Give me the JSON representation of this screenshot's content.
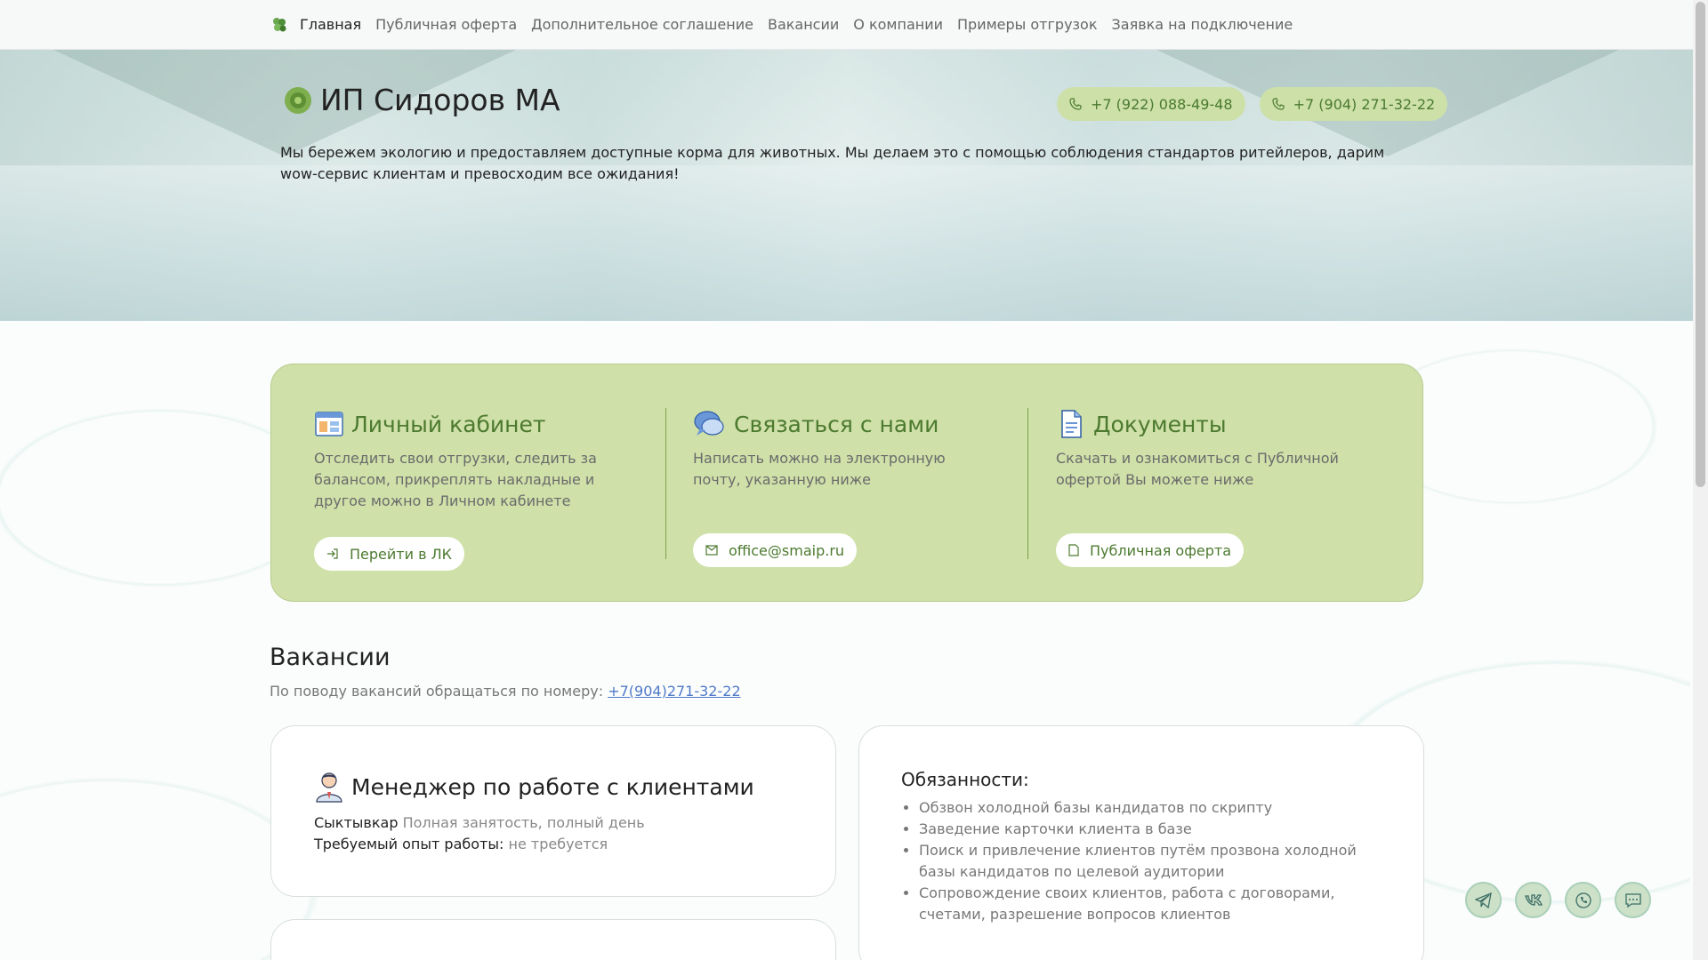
{
  "nav": {
    "items": [
      {
        "label": "Главная",
        "active": true
      },
      {
        "label": "Публичная оферта",
        "active": false
      },
      {
        "label": "Дополнительное соглашение",
        "active": false
      },
      {
        "label": "Вакансии",
        "active": false
      },
      {
        "label": "О компании",
        "active": false
      },
      {
        "label": "Примеры отгрузок",
        "active": false
      },
      {
        "label": "Заявка на подключение",
        "active": false
      }
    ]
  },
  "hero": {
    "title": "ИП Сидоров МА",
    "phones": [
      "+7 (922) 088-49-48",
      "+7 (904) 271-32-22"
    ],
    "description": "Мы бережем экологию и предоставляем доступные корма для животных. Мы делаем это с помощью соблюдения стандартов ритейлеров, дарим wow-сервис клиентам и превосходим все ожидания!"
  },
  "features": {
    "account": {
      "title": "Личный кабинет",
      "text": "Отследить свои отгрузки, следить за балансом, прикреплять накладные и другое можно в Личном кабинете",
      "button": "Перейти в ЛК"
    },
    "contact": {
      "title": "Связаться с нами",
      "text": "Написать можно на электронную почту, указанную ниже",
      "button": "office@smaip.ru"
    },
    "documents": {
      "title": "Документы",
      "text": "Скачать и ознакомиться с Публичной офертой Вы можете ниже",
      "button": "Публичная оферта"
    }
  },
  "vacancies": {
    "title": "Вакансии",
    "subtitle": "По поводу вакансий обращаться по номеру:",
    "phone_link": "+7(904)271-32-22",
    "job": {
      "title": "Менеджер по работе с клиентами",
      "city": "Сыктывкар",
      "schedule": "Полная занятость, полный день",
      "experience_label": "Требуемый опыт работы:",
      "experience_value": "не требуется"
    },
    "duties": {
      "title": "Обязанности:",
      "items": [
        "Обзвон холодной базы кандидатов по скрипту",
        "Заведение карточки клиента в базе",
        "Поиск и привлечение клиентов путём прозвона холодной базы кандидатов по целевой аудитории",
        "Сопровождение своих клиентов, работа с договорами, счетами, разрешение вопросов клиентов"
      ]
    }
  },
  "floating_buttons": [
    "telegram-icon",
    "vk-icon",
    "whatsapp-icon",
    "chat-icon"
  ],
  "colors": {
    "accent_green": "#4c7a2f",
    "card_green": "#cfe0a9",
    "link_blue": "#4f79c9"
  }
}
